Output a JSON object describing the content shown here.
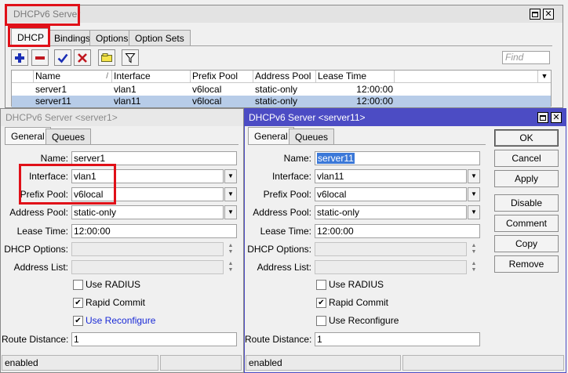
{
  "main_window": {
    "title": "DHCPv6 Server",
    "tabs": [
      "DHCP",
      "Bindings",
      "Options",
      "Option Sets"
    ],
    "find_placeholder": "Find",
    "columns": [
      "Name",
      "Interface",
      "Prefix Pool",
      "Address Pool",
      "Lease Time"
    ],
    "rows": [
      {
        "name": "server1",
        "interface": "vlan1",
        "prefix_pool": "v6local",
        "address_pool": "static-only",
        "lease_time": "12:00:00"
      },
      {
        "name": "server11",
        "interface": "vlan11",
        "prefix_pool": "v6local",
        "address_pool": "static-only",
        "lease_time": "12:00:00"
      }
    ]
  },
  "dialog1": {
    "title": "DHCPv6 Server <server1>",
    "tabs": [
      "General",
      "Queues"
    ],
    "labels": {
      "name": "Name:",
      "interface": "Interface:",
      "prefix_pool": "Prefix Pool:",
      "address_pool": "Address Pool:",
      "lease_time": "Lease Time:",
      "dhcp_options": "DHCP Options:",
      "address_list": "Address List:",
      "use_radius": "Use RADIUS",
      "rapid_commit": "Rapid Commit",
      "use_reconfigure": "Use Reconfigure",
      "route_distance": "Route Distance:"
    },
    "values": {
      "name": "server1",
      "interface": "vlan1",
      "prefix_pool": "v6local",
      "address_pool": "static-only",
      "lease_time": "12:00:00",
      "dhcp_options": "",
      "address_list": "",
      "route_distance": "1"
    },
    "checks": {
      "use_radius": false,
      "rapid_commit": true,
      "use_reconfigure": true
    },
    "status": "enabled"
  },
  "dialog2": {
    "title": "DHCPv6 Server <server11>",
    "tabs": [
      "General",
      "Queues"
    ],
    "labels": {
      "name": "Name:",
      "interface": "Interface:",
      "prefix_pool": "Prefix Pool:",
      "address_pool": "Address Pool:",
      "lease_time": "Lease Time:",
      "dhcp_options": "DHCP Options:",
      "address_list": "Address List:",
      "use_radius": "Use RADIUS",
      "rapid_commit": "Rapid Commit",
      "use_reconfigure": "Use Reconfigure",
      "route_distance": "Route Distance:"
    },
    "values": {
      "name": "server11",
      "interface": "vlan11",
      "prefix_pool": "v6local",
      "address_pool": "static-only",
      "lease_time": "12:00:00",
      "dhcp_options": "",
      "address_list": "",
      "route_distance": "1"
    },
    "checks": {
      "use_radius": false,
      "rapid_commit": true,
      "use_reconfigure": false
    },
    "status": "enabled",
    "buttons": [
      "OK",
      "Cancel",
      "Apply",
      "Disable",
      "Comment",
      "Copy",
      "Remove"
    ]
  },
  "icons": {
    "add": "plus-icon",
    "remove": "minus-icon",
    "enable": "check-icon",
    "disable": "x-icon",
    "comment": "comment-icon",
    "filter": "filter-icon"
  },
  "colors": {
    "highlight": "#e01018",
    "selected_row": "#b7cce8",
    "active_title": "#4c4cc4",
    "link_blue": "#1a2ad6"
  }
}
